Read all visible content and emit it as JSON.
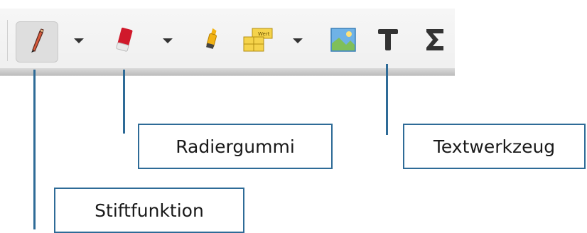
{
  "toolbar": {
    "tools": [
      {
        "name": "pencil",
        "active": true
      },
      {
        "name": "eraser"
      },
      {
        "name": "highlighter"
      },
      {
        "name": "table"
      },
      {
        "name": "image"
      },
      {
        "name": "text"
      },
      {
        "name": "sigma"
      }
    ]
  },
  "callouts": {
    "stift": "Stiftfunktion",
    "radier": "Radiergummi",
    "text": "Textwerkzeug"
  },
  "colors": {
    "callout": "#2e6b97",
    "pencil": "#d85a3c",
    "eraser": "#d0192b",
    "highlighter": "#f2b315",
    "image_sky": "#6fb2e6",
    "image_ground": "#7fbf5a"
  },
  "icon_text": {
    "table_glyphs": "Wert"
  }
}
